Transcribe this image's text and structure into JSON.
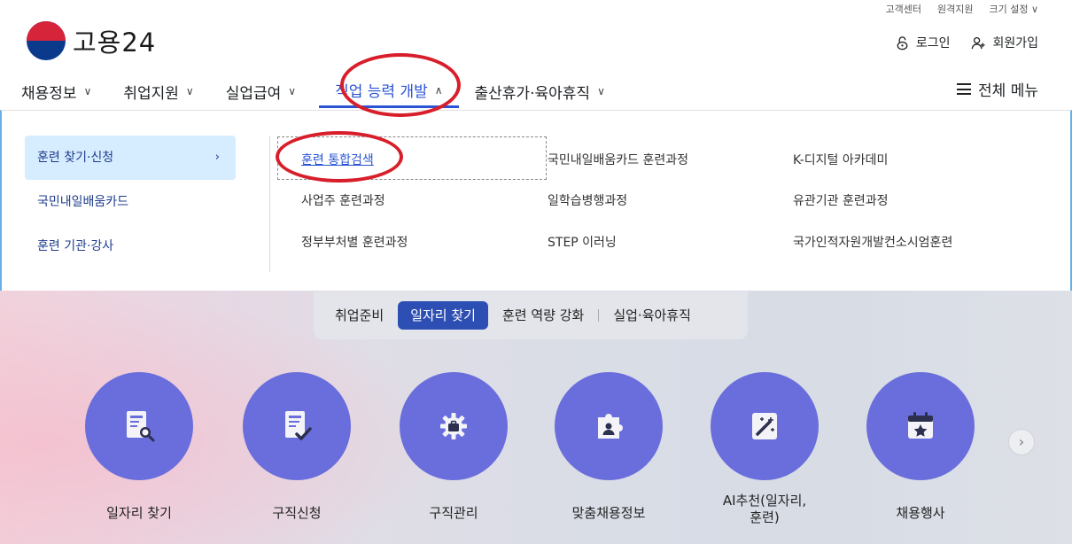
{
  "header": {
    "util_links": [
      "고객센터",
      "원격지원",
      "크기 설정 ∨"
    ],
    "logo_text": "고용24",
    "login": "로그인",
    "signup": "회원가입"
  },
  "gnb": {
    "items": [
      {
        "label": "채용정보",
        "chevron": "∨"
      },
      {
        "label": "취업지원",
        "chevron": "∨"
      },
      {
        "label": "실업급여",
        "chevron": "∨"
      },
      {
        "label": "직업 능력 개발",
        "chevron": "∧"
      },
      {
        "label": "출산휴가·육아휴직",
        "chevron": "∨"
      }
    ],
    "full_menu": "전체 메뉴"
  },
  "mega_menu": {
    "side_items": [
      {
        "label": "훈련 찾기·신청",
        "arrow": "›"
      },
      {
        "label": "국민내일배움카드"
      },
      {
        "label": "훈련 기관·강사"
      }
    ],
    "sub_items": [
      "훈련 통합검색",
      "국민내일배움카드 훈련과정",
      "K-디지털 아카데미",
      "사업주 훈련과정",
      "일학습병행과정",
      "유관기관 훈련과정",
      "정부부처별 훈련과정",
      "STEP 이러닝",
      "국가인적자원개발컨소시엄훈련"
    ]
  },
  "hero_tabs": [
    "취업준비",
    "일자리 찾기",
    "훈련 역량 강화",
    "실업·육아휴직"
  ],
  "services": [
    {
      "label": "일자리 찾기",
      "icon": "document-search-icon"
    },
    {
      "label": "구직신청",
      "icon": "document-check-icon"
    },
    {
      "label": "구직관리",
      "icon": "gear-briefcase-icon"
    },
    {
      "label": "맞춤채용정보",
      "icon": "puzzle-person-icon"
    },
    {
      "label": "AI추천(일자리,\n훈련)",
      "icon": "magic-wand-icon"
    },
    {
      "label": "채용행사",
      "icon": "calendar-star-icon"
    }
  ],
  "next_button": "›",
  "colors": {
    "accent": "#2a54d4",
    "circle": "#6a6edc",
    "annotation": "#d81e2a",
    "side_active": "#d6ecff"
  }
}
